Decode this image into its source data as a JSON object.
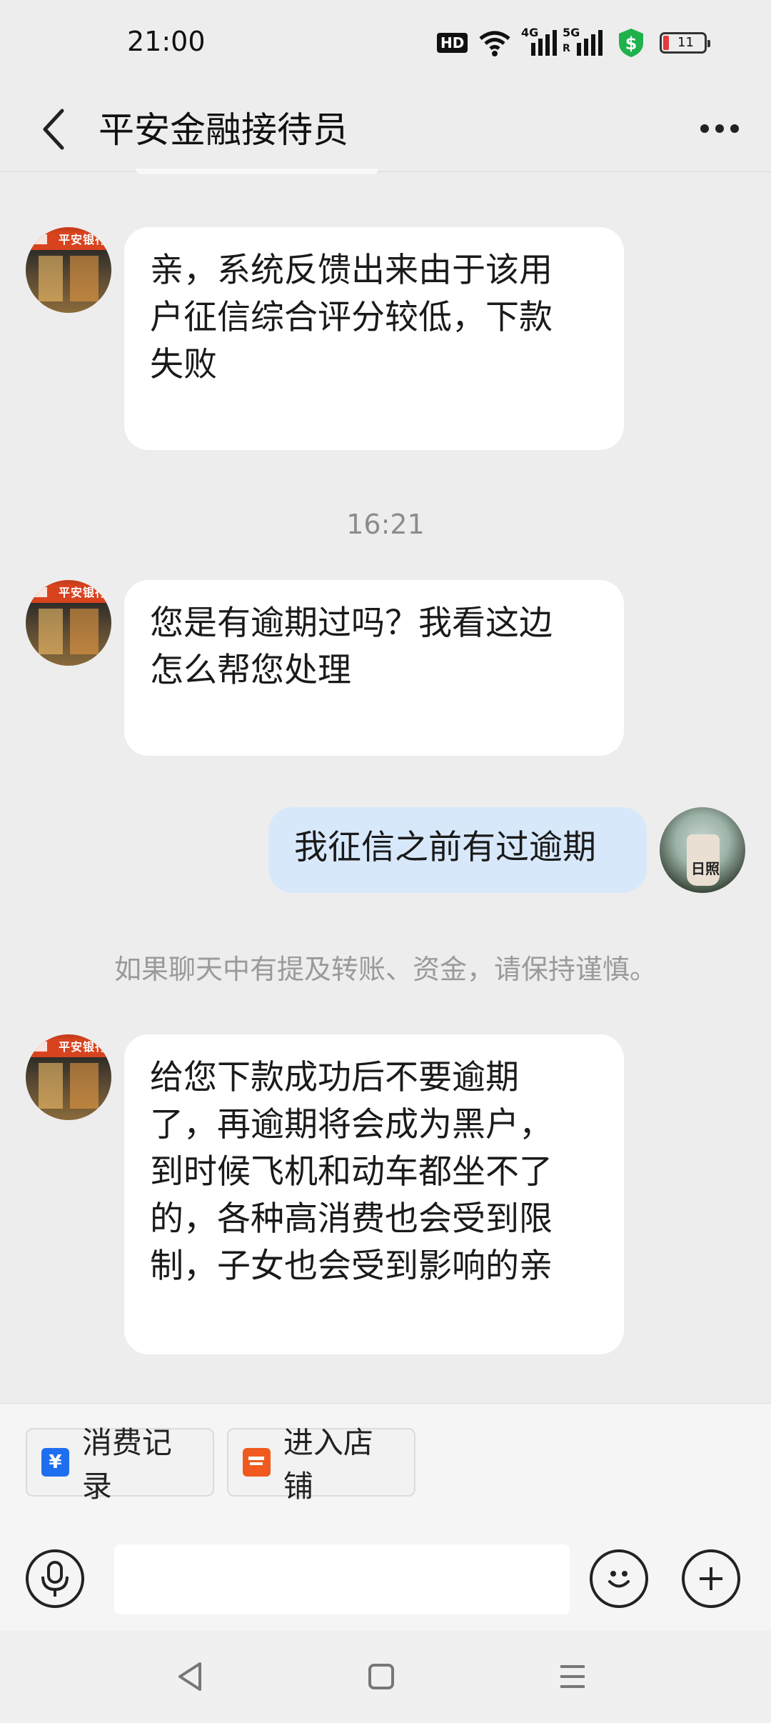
{
  "status_bar": {
    "time": "21:00",
    "icons": [
      "hd-icon",
      "wifi-icon",
      "signal-4g-icon",
      "signal-5g-icon",
      "shield-dollar-icon",
      "battery-icon"
    ],
    "network_1": "4G",
    "network_2": "5G",
    "hd_label": "HD",
    "battery_level": "11"
  },
  "header": {
    "title": "平安金融接待员",
    "back_icon": "chevron-left-icon",
    "more_icon": "more-dots-icon"
  },
  "messages": [
    {
      "side": "incoming",
      "text_lines": [
        "亲，系统反馈出来由于该用",
        "户征信综合评分较低，下款",
        "失败"
      ]
    },
    {
      "type": "timestamp",
      "text": "16:21"
    },
    {
      "side": "incoming",
      "text_lines": [
        "您是有逾期过吗？我看这边",
        "怎么帮您处理"
      ]
    },
    {
      "side": "outgoing",
      "text_lines": [
        "我征信之前有过逾期"
      ]
    },
    {
      "type": "notice",
      "text": "如果聊天中有提及转账、资金，请保持谨慎。"
    },
    {
      "side": "incoming",
      "text_lines": [
        "给您下款成功后不要逾期",
        "了，再逾期将会成为黑户，",
        "到时候飞机和动车都坐不了",
        "的，各种高消费也会受到限",
        "制，子女也会受到影响的亲"
      ]
    }
  ],
  "bank_avatar_sign": "平安银行",
  "user_avatar_text": "日照",
  "quick_actions": [
    {
      "label": "消费记录",
      "icon": "yuan-receipt-icon",
      "color": "#1e6ef0",
      "glyph": "¥"
    },
    {
      "label": "进入店铺",
      "icon": "store-icon",
      "color": "#f05a1e",
      "glyph": "▬"
    }
  ],
  "input": {
    "placeholder": "",
    "voice_icon": "microphone-icon",
    "emoji_icon": "smiley-icon",
    "plus_icon": "plus-icon"
  },
  "nav_bar": {
    "icons": [
      "back-triangle-icon",
      "home-square-icon",
      "menu-lines-icon"
    ]
  },
  "colors": {
    "background": "#ededed",
    "incoming_bubble": "#ffffff",
    "outgoing_bubble": "#d8e8fb"
  }
}
